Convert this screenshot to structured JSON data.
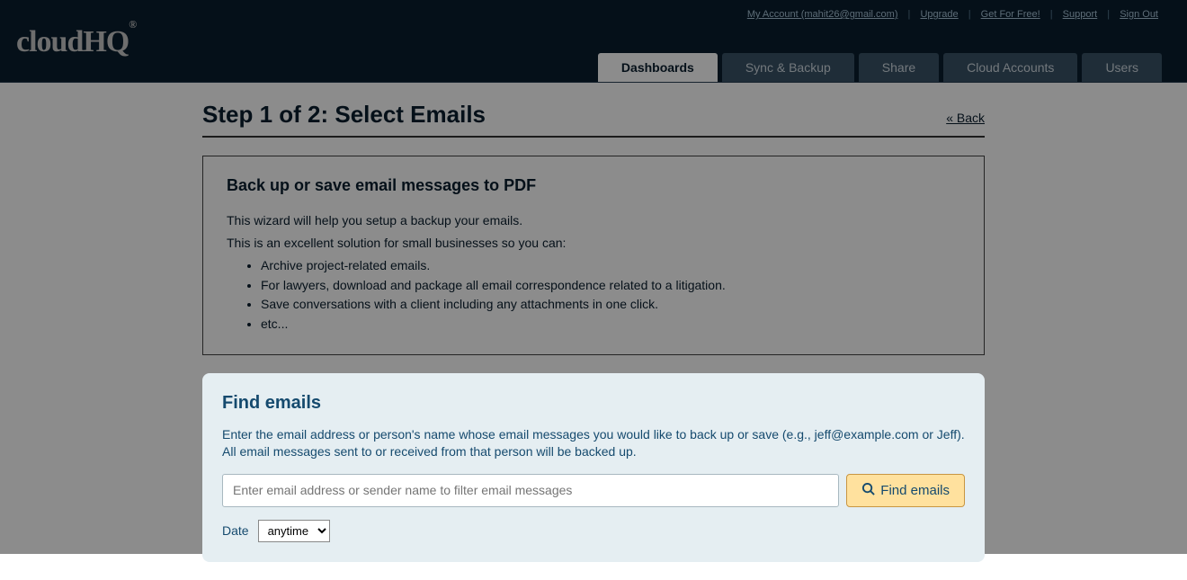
{
  "logo": "cloudHQ",
  "topLinks": {
    "account": "My Account (mahit26@gmail.com)",
    "upgrade": "Upgrade",
    "getFree": "Get For Free!",
    "support": "Support",
    "signOut": "Sign Out"
  },
  "tabs": {
    "dashboards": "Dashboards",
    "syncBackup": "Sync & Backup",
    "share": "Share",
    "cloudAccounts": "Cloud Accounts",
    "users": "Users"
  },
  "step": {
    "title": "Step 1 of 2: Select Emails",
    "back": "« Back"
  },
  "info": {
    "heading": "Back up or save email messages to PDF",
    "p1": "This wizard will help you setup a backup your emails.",
    "p2": "This is an excellent solution for small businesses so you can:",
    "li1": "Archive project-related emails.",
    "li2": "For lawyers, download and package all email correspondence related to a litigation.",
    "li3": "Save conversations with a client including any attachments in one click.",
    "li4": "etc..."
  },
  "find": {
    "heading": "Find emails",
    "desc": "Enter the email address or person's name whose email messages you would like to back up or save (e.g., jeff@example.com or Jeff). All email messages sent to or received from that person will be backed up.",
    "placeholder": "Enter email address or sender name to filter email messages",
    "button": "Find emails",
    "dateLabel": "Date",
    "dateValue": "anytime"
  }
}
